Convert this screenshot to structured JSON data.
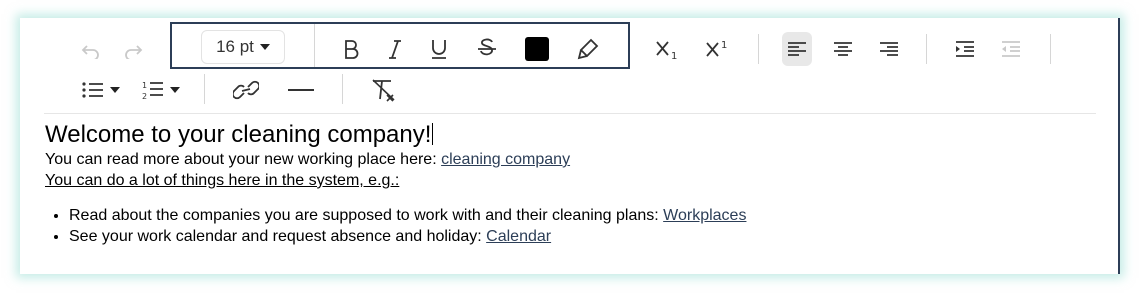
{
  "toolbar": {
    "font_size": "16 pt",
    "text_color": "#000000",
    "highlight_border_color": "#2c3e57",
    "active_button": "align-left",
    "icons": [
      "undo-icon",
      "redo-icon",
      "bold-icon",
      "italic-icon",
      "underline-icon",
      "strikethrough-icon",
      "text-color-swatch",
      "highlighter-icon",
      "subscript-icon",
      "superscript-icon",
      "align-left-icon",
      "align-center-icon",
      "align-right-icon",
      "indent-increase-icon",
      "indent-decrease-icon",
      "bullet-list-icon",
      "numbered-list-icon",
      "link-icon",
      "horizontal-rule-icon",
      "clear-formatting-icon"
    ]
  },
  "content": {
    "heading": "Welcome to your cleaning company!",
    "line1_text": "You can read more about your new working place here: ",
    "line1_link": "cleaning company",
    "line2": "You can do a lot of things here in the system, e.g.:",
    "items": [
      {
        "text": "Read about the companies you are supposed to work with and their cleaning plans: ",
        "link": "Workplaces"
      },
      {
        "text": "See your work calendar and request absence and holiday: ",
        "link": "Calendar"
      }
    ]
  }
}
